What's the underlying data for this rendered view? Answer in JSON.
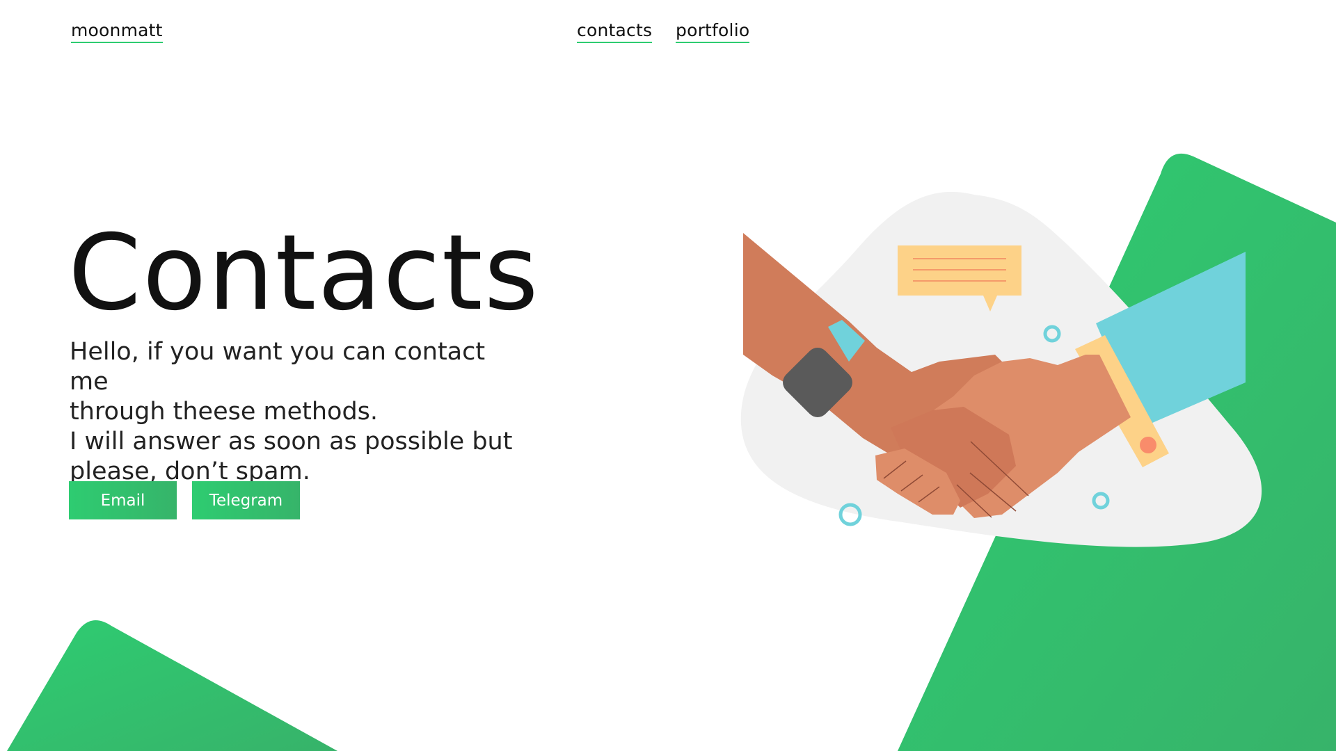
{
  "nav": {
    "logo": "moonmatt",
    "links": [
      {
        "label": "contacts"
      },
      {
        "label": "portfolio"
      }
    ]
  },
  "hero": {
    "title": "Contacts",
    "lines": [
      "Hello, if you want you can contact me",
      "through theese methods.",
      "I will answer as soon as possible but",
      "please, don’t spam."
    ]
  },
  "buttons": {
    "email": "Email",
    "telegram": "Telegram"
  },
  "colors": {
    "accent": "#2ecc71",
    "accent_dark": "#36b46a",
    "text": "#111111"
  },
  "illustration": {
    "icon": "handshake-illustration"
  }
}
